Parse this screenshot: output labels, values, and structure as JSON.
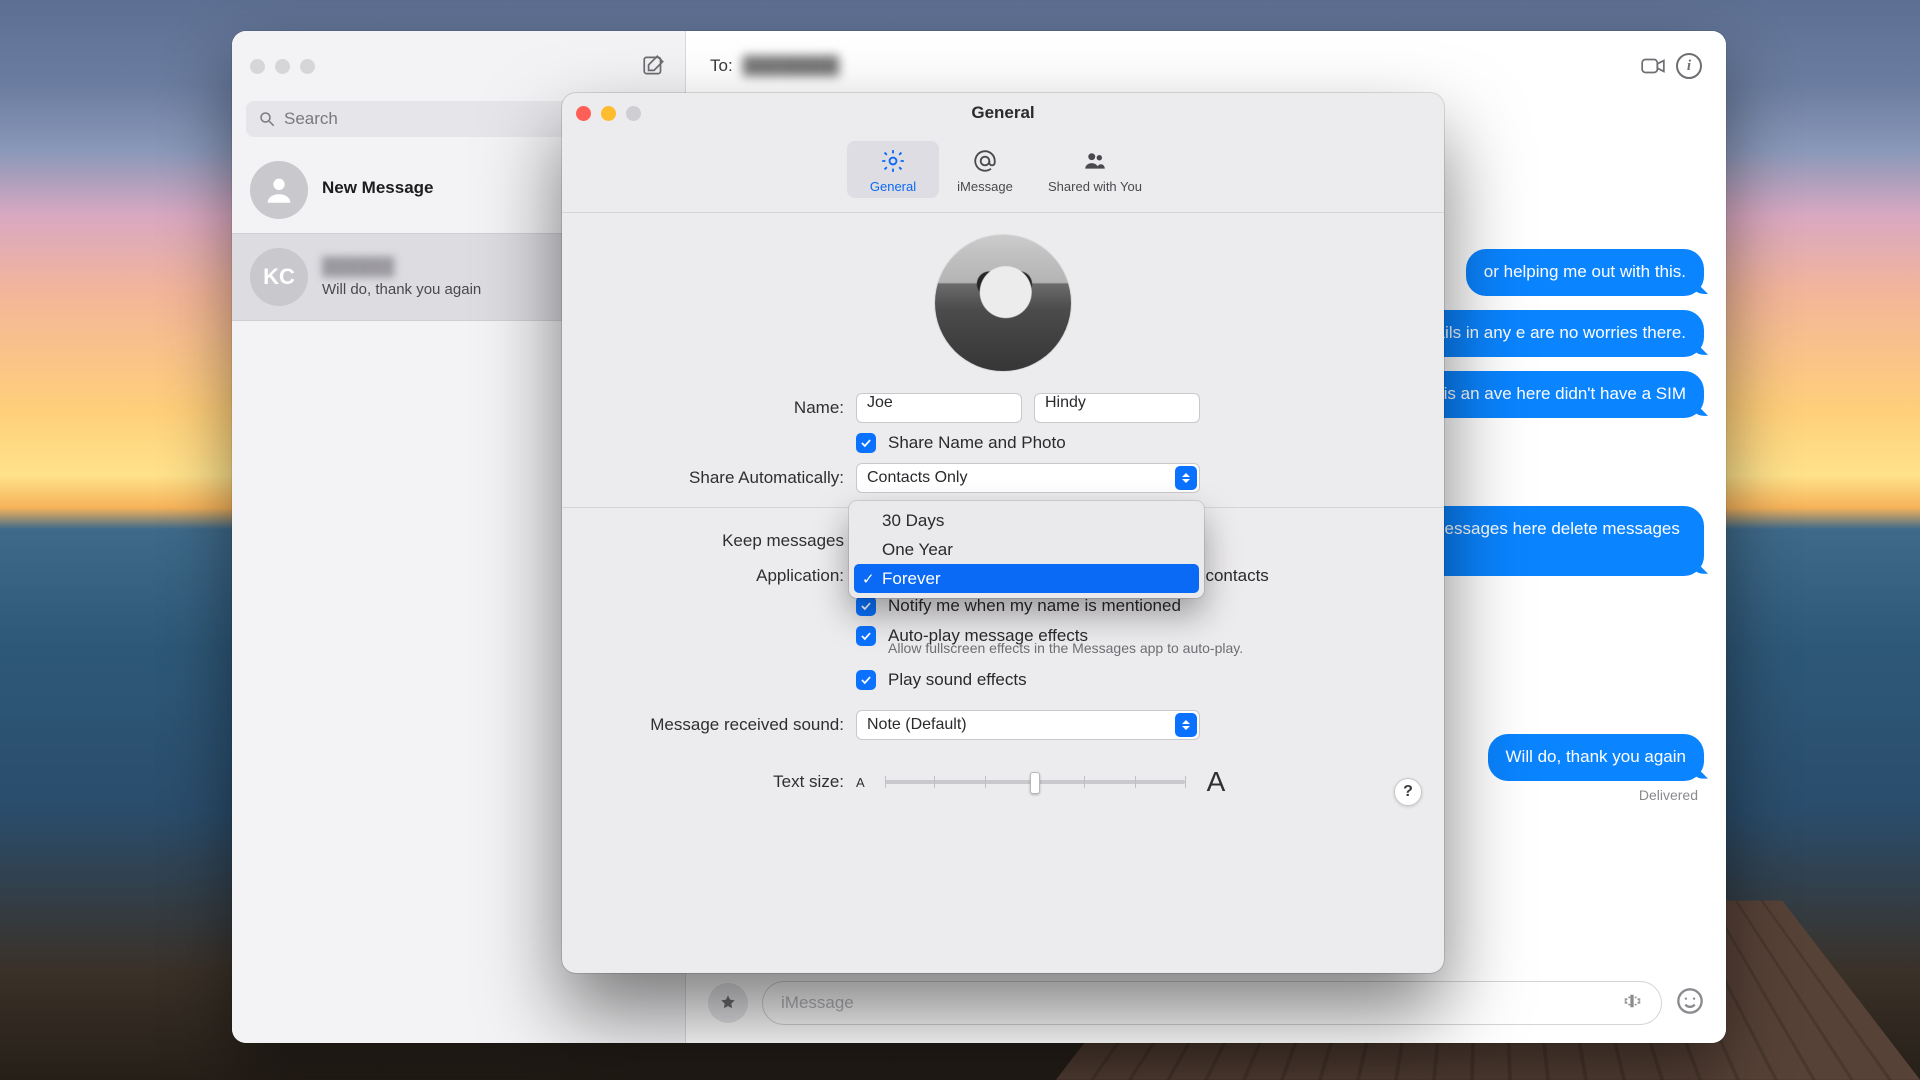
{
  "messages_window": {
    "sidebar": {
      "search_placeholder": "Search",
      "conversations": [
        {
          "name": "New Message",
          "preview": "",
          "initials": ""
        },
        {
          "name": "██████",
          "preview": "Will do, thank you again",
          "initials": "KC"
        }
      ]
    },
    "header": {
      "to_label": "To:",
      "recipient": "████████"
    },
    "bubbles": [
      "or helping me out with this.",
      "any personal details in any e are no worries there.",
      "one number and mine is an ave here didn't have a SIM",
      "to an activated iPhone. aving a few messages here delete messages in some karma 😊 thank you",
      "Will do, thank you again"
    ],
    "delivered_label": "Delivered",
    "compose_placeholder": "iMessage"
  },
  "prefs": {
    "title": "General",
    "tabs": {
      "general": "General",
      "imessage": "iMessage",
      "shared": "Shared with You"
    },
    "name_label": "Name:",
    "first_name": "Joe",
    "last_name": "Hindy",
    "share_name_photo": "Share Name and Photo",
    "share_auto_label": "Share Automatically:",
    "share_auto_value": "Contacts Only",
    "keep_label": "Keep messages",
    "keep_options": [
      "30 Days",
      "One Year",
      "Forever"
    ],
    "keep_selected": "Forever",
    "application_label": "Application:",
    "notify_unknown": "Notify me about messages from unknown contacts",
    "notify_mention": "Notify me when my name is mentioned",
    "autoplay_effects": "Auto-play message effects",
    "autoplay_hint": "Allow fullscreen effects in the Messages app to auto-play.",
    "sound_effects": "Play sound effects",
    "received_sound_label": "Message received sound:",
    "received_sound_value": "Note (Default)",
    "text_size_label": "Text size:",
    "help": "?"
  }
}
